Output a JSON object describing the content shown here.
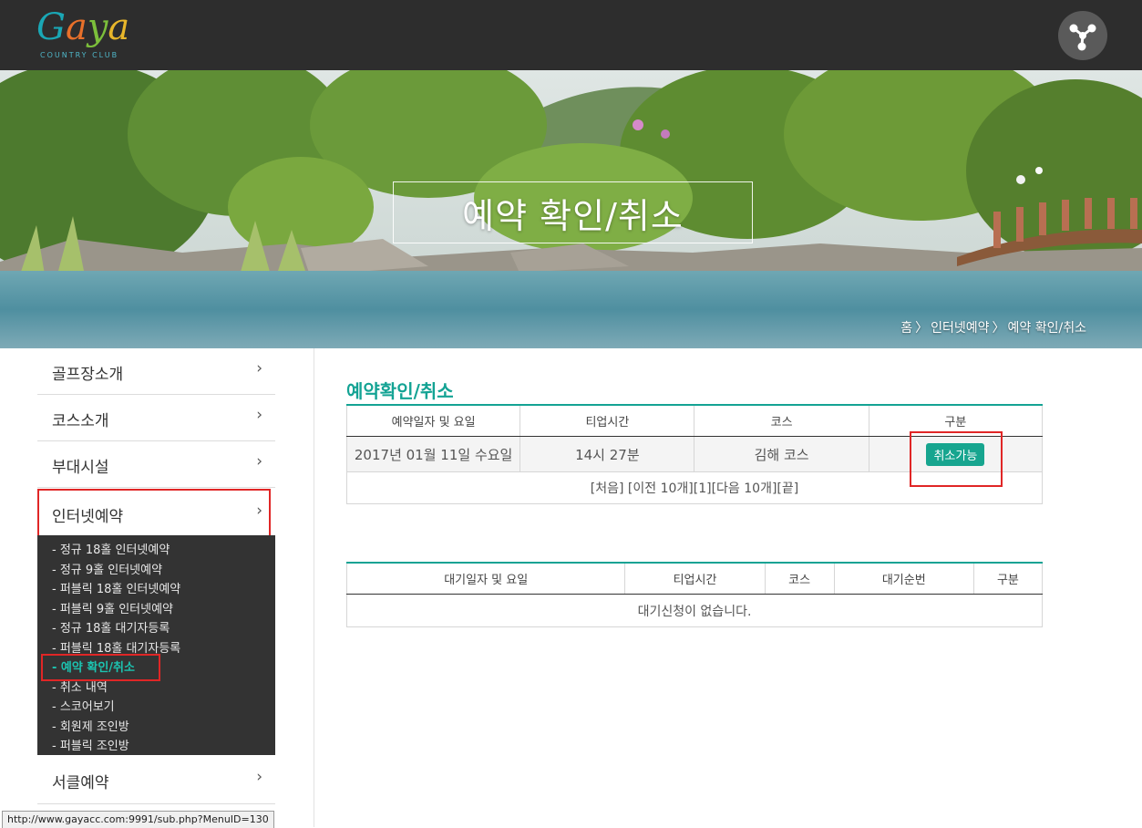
{
  "header": {
    "logo_text": "Gaya",
    "logo_subtitle": "COUNTRY CLUB",
    "share_icon": "share-network-icon"
  },
  "hero": {
    "title": "예약 확인/취소",
    "breadcrumb": [
      "홈",
      "인터넷예약",
      "예약 확인/취소"
    ],
    "breadcrumb_separator": "〉"
  },
  "sidebar": {
    "items": [
      {
        "label": "골프장소개"
      },
      {
        "label": "코스소개"
      },
      {
        "label": "부대시설"
      },
      {
        "label": "인터넷예약"
      }
    ],
    "submenu": [
      {
        "label": "- 정규 18홀 인터넷예약"
      },
      {
        "label": "- 정규 9홀 인터넷예약"
      },
      {
        "label": "- 퍼블릭 18홀 인터넷예약"
      },
      {
        "label": "- 퍼블릭 9홀 인터넷예약"
      },
      {
        "label": "- 정규 18홀 대기자등록"
      },
      {
        "label": "- 퍼블릭 18홀 대기자등록"
      },
      {
        "label": "- 예약 확인/취소"
      },
      {
        "label": "- 취소 내역"
      },
      {
        "label": "- 스코어보기"
      },
      {
        "label": "- 회원제 조인방"
      },
      {
        "label": "- 퍼블릭 조인방"
      }
    ],
    "last_item": {
      "label": "서클예약"
    },
    "chevron": "›"
  },
  "reservations": {
    "title": "예약확인/취소",
    "columns": [
      "예약일자 및 요일",
      "티업시간",
      "코스",
      "구분"
    ],
    "rows": [
      {
        "date": "2017년 01월 11일 수요일",
        "time": "14시 27분",
        "course": "김해 코스",
        "action": "취소가능"
      }
    ],
    "pager": [
      "[처음]",
      "[이전 10개]",
      "[1]",
      "[다음 10개]",
      "[끝]"
    ]
  },
  "waitlist": {
    "columns": [
      "대기일자 및 요일",
      "티업시간",
      "코스",
      "대기순번",
      "구분"
    ],
    "empty_message": "대기신청이 없습니다."
  },
  "statusbar": {
    "url": "http://www.gayacc.com:9991/sub.php?MenuID=130"
  },
  "colors": {
    "topbar": "#2d2d2d",
    "accent": "#14a394",
    "button": "#17a58f",
    "highlight": "#e02626"
  }
}
